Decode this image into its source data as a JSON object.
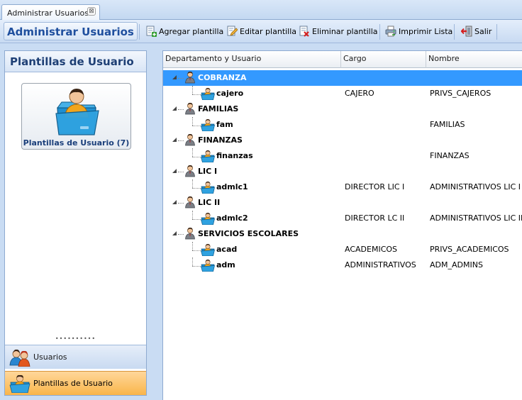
{
  "tab": {
    "label": "Administrar Usuarios",
    "close_symbol": "⊠"
  },
  "toolbar": {
    "title": "Administrar Usuarios",
    "buttons": [
      {
        "label": "Agregar plantilla",
        "icon": "add-template-icon"
      },
      {
        "label": "Editar plantilla",
        "icon": "edit-template-icon"
      },
      {
        "label": "Eliminar plantilla",
        "icon": "delete-template-icon"
      },
      {
        "label": "Imprimir Lista",
        "icon": "printer-icon"
      },
      {
        "label": "Salir",
        "icon": "exit-icon"
      }
    ]
  },
  "left_panel": {
    "title": "Plantillas de Usuario",
    "tile_label": "Plantillas de Usuario (7)",
    "splitter_dots": "••••••••••",
    "nav": [
      {
        "label": "Usuarios",
        "icon": "users-icon",
        "active": false
      },
      {
        "label": "Plantillas de Usuario",
        "icon": "user-folder-icon",
        "active": true
      }
    ]
  },
  "grid": {
    "columns": [
      "Departamento y Usuario",
      "Cargo",
      "Nombre"
    ],
    "rows": [
      {
        "type": "department",
        "name": "COBRANZA",
        "cargo": "",
        "nombre": "",
        "selected": true
      },
      {
        "type": "user",
        "name": "cajero",
        "cargo": "CAJERO",
        "nombre": "PRIVS_CAJEROS"
      },
      {
        "type": "department",
        "name": "FAMILIAS",
        "cargo": "",
        "nombre": ""
      },
      {
        "type": "user",
        "name": "fam",
        "cargo": "",
        "nombre": "FAMILIAS"
      },
      {
        "type": "department",
        "name": "FINANZAS",
        "cargo": "",
        "nombre": ""
      },
      {
        "type": "user",
        "name": "finanzas",
        "cargo": "",
        "nombre": "FINANZAS"
      },
      {
        "type": "department",
        "name": "LIC I",
        "cargo": "",
        "nombre": ""
      },
      {
        "type": "user",
        "name": "admlc1",
        "cargo": "DIRECTOR LIC I",
        "nombre": "ADMINISTRATIVOS LIC I"
      },
      {
        "type": "department",
        "name": "LIC II",
        "cargo": "",
        "nombre": ""
      },
      {
        "type": "user",
        "name": "admlc2",
        "cargo": "DIRECTOR LC II",
        "nombre": "ADMINISTRATIVOS LIC II"
      },
      {
        "type": "department",
        "name": "SERVICIOS ESCOLARES",
        "cargo": "",
        "nombre": ""
      },
      {
        "type": "user",
        "name": "acad",
        "cargo": "ACADEMICOS",
        "nombre": "PRIVS_ACADEMICOS"
      },
      {
        "type": "user",
        "name": "adm",
        "cargo": "ADMINISTRATIVOS",
        "nombre": "ADM_ADMINS"
      }
    ]
  },
  "colors": {
    "selection": "#3399ff",
    "title_blue": "#1f4f9e",
    "active_nav": "#f9b54a",
    "background": "#c9dcf3"
  }
}
